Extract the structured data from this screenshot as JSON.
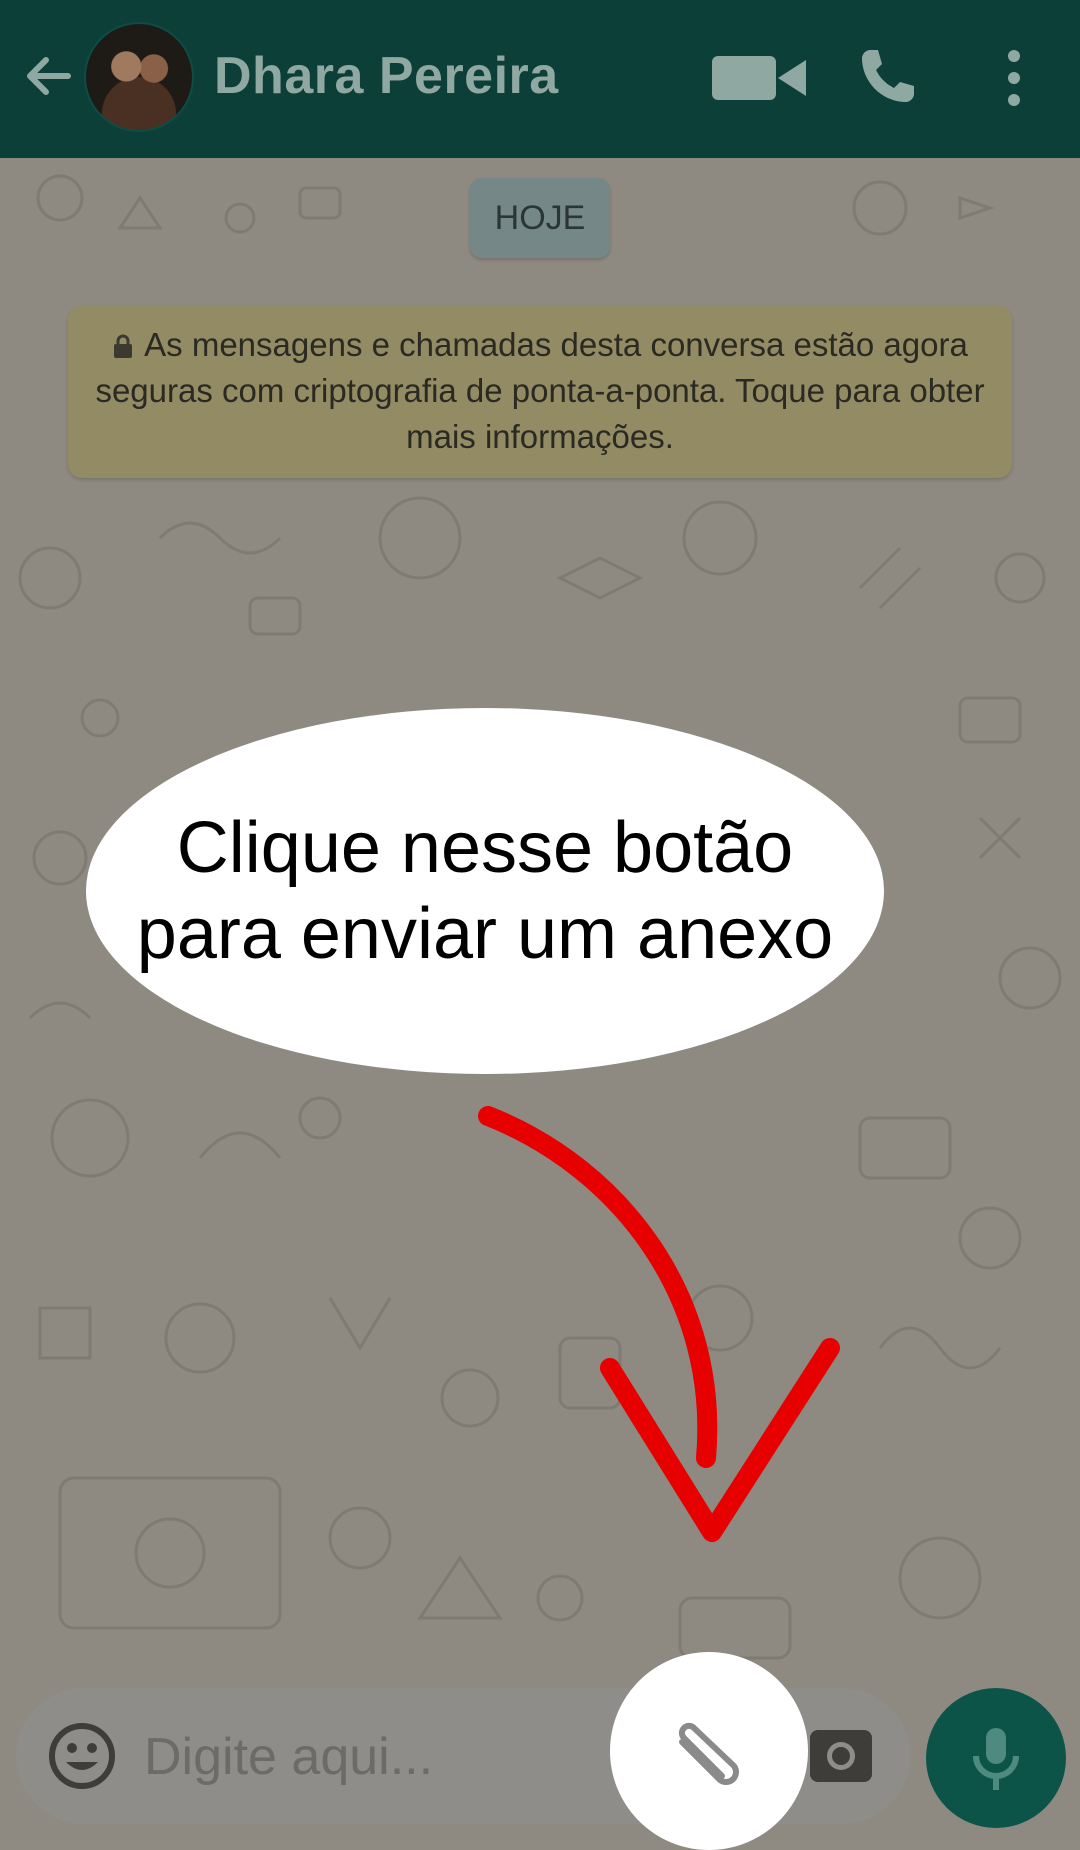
{
  "header": {
    "contact_name": "Dhara Pereira",
    "icons": [
      "back-arrow-icon",
      "avatar",
      "video-call-icon",
      "phone-icon",
      "more-options-icon"
    ]
  },
  "chat": {
    "date_chip": "HOJE",
    "encryption_notice": "As mensagens e chamadas desta conversa estão agora seguras com criptografia de ponta-a-ponta. Toque para obter mais informações."
  },
  "annotation": {
    "callout_line1": "Clique nesse botão",
    "callout_line2": "para enviar um anexo",
    "arrow_color": "#e60000"
  },
  "input_bar": {
    "placeholder": "Digite aqui...",
    "icons": [
      "emoji-icon",
      "paperclip-icon",
      "camera-icon",
      "microphone-icon"
    ]
  },
  "colors": {
    "header_bg": "#0b3f37",
    "accent": "#0d5448"
  }
}
